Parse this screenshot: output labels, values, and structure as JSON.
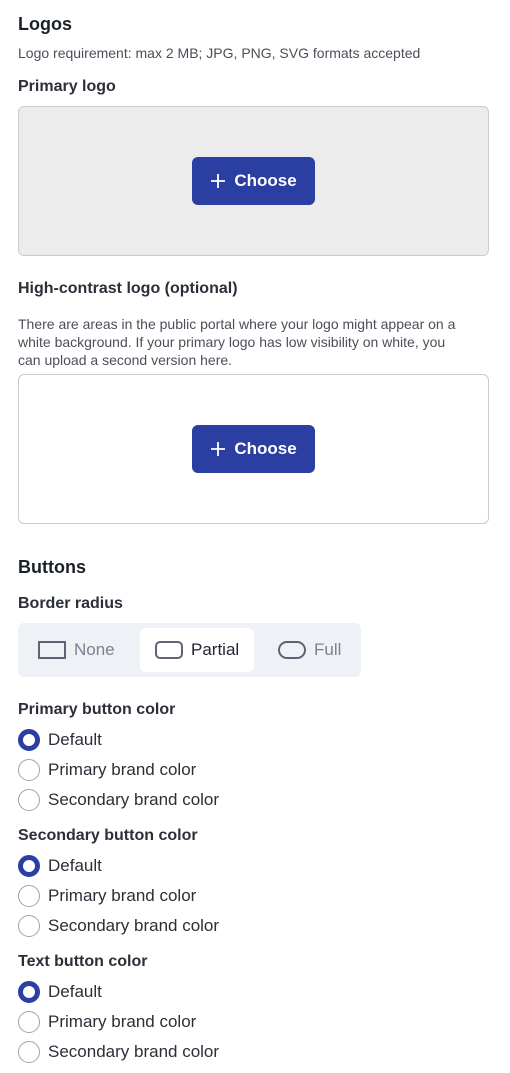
{
  "logos": {
    "title": "Logos",
    "requirement": "Logo requirement: max 2 MB; JPG, PNG, SVG formats accepted",
    "primary_label": "Primary logo",
    "choose_label": "Choose",
    "high_contrast_label": "High-contrast logo (optional)",
    "high_contrast_desc_1": "There are areas in the public portal where your logo might appear on a",
    "high_contrast_desc_2": "white background. If your primary logo has low visibility on white, you",
    "high_contrast_desc_3": "can upload a second version here."
  },
  "buttons": {
    "title": "Buttons",
    "border_radius_label": "Border radius",
    "radius_options": [
      "None",
      "Partial",
      "Full"
    ],
    "radius_selected": "Partial",
    "groups": [
      {
        "label": "Primary button color",
        "options": [
          "Default",
          "Primary brand color",
          "Secondary brand color"
        ],
        "selected": "Default"
      },
      {
        "label": "Secondary button color",
        "options": [
          "Default",
          "Primary brand color",
          "Secondary brand color"
        ],
        "selected": "Default"
      },
      {
        "label": "Text button color",
        "options": [
          "Default",
          "Primary brand color",
          "Secondary brand color"
        ],
        "selected": "Default"
      }
    ]
  },
  "colors": {
    "accent": "#2a3fa1",
    "dropzone_grey": "#ececec",
    "segment_bg": "#eef1f6"
  },
  "icons": {
    "plus": "plus-icon",
    "radius_none": "square-corner-icon",
    "radius_partial": "rounded-corner-icon",
    "radius_full": "pill-corner-icon"
  }
}
